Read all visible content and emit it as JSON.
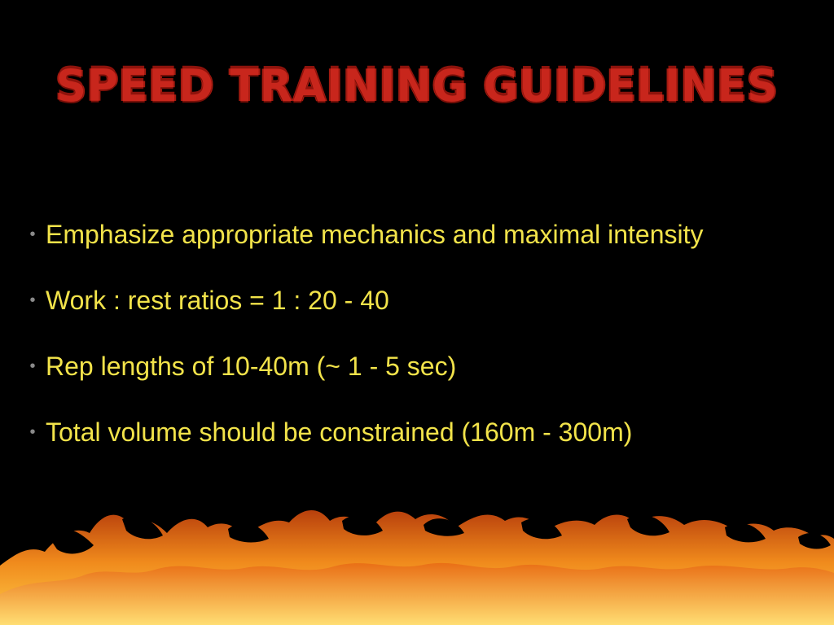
{
  "slide": {
    "title": "SPEED TRAINING GUIDELINES",
    "bullet_symbol": "•",
    "bullets": [
      "Emphasize appropriate mechanics and maximal intensity",
      "Work : rest ratios = 1 : 20 - 40",
      "Rep lengths of 10-40m (~ 1 - 5 sec)",
      "Total volume should be constrained (160m - 300m)"
    ]
  },
  "colors": {
    "background": "#000000",
    "title": "#c8261c",
    "bullet_text": "#f2e34a",
    "bullet_symbol": "#8a8a8a",
    "fire_core": "#ffcf4a",
    "fire_mid": "#f08a1c",
    "fire_dark": "#b8400c"
  },
  "decoration": {
    "bottom_image": "fire-flames-icon"
  }
}
